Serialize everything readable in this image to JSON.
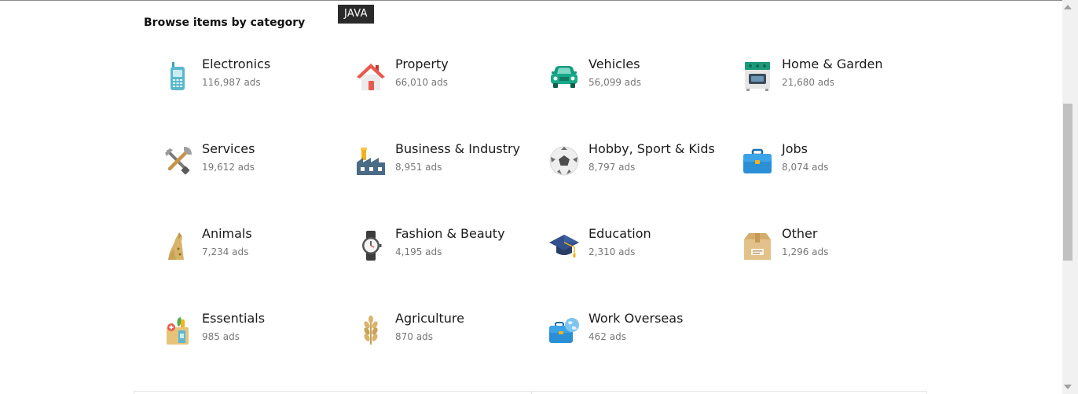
{
  "page": {
    "title": "Browse items by category"
  },
  "tooltip": {
    "text": "JAVA"
  },
  "categories": [
    {
      "label": "Electronics",
      "count": "116,987 ads",
      "icon": "phone-icon"
    },
    {
      "label": "Property",
      "count": "66,010 ads",
      "icon": "house-icon"
    },
    {
      "label": "Vehicles",
      "count": "56,099 ads",
      "icon": "car-icon"
    },
    {
      "label": "Home & Garden",
      "count": "21,680 ads",
      "icon": "stove-icon"
    },
    {
      "label": "Services",
      "count": "19,612 ads",
      "icon": "tools-icon"
    },
    {
      "label": "Business & Industry",
      "count": "8,951 ads",
      "icon": "factory-icon"
    },
    {
      "label": "Hobby, Sport & Kids",
      "count": "8,797 ads",
      "icon": "football-icon"
    },
    {
      "label": "Jobs",
      "count": "8,074 ads",
      "icon": "briefcase-icon"
    },
    {
      "label": "Animals",
      "count": "7,234 ads",
      "icon": "dog-icon"
    },
    {
      "label": "Fashion & Beauty",
      "count": "4,195 ads",
      "icon": "watch-icon"
    },
    {
      "label": "Education",
      "count": "2,310 ads",
      "icon": "graduation-cap-icon"
    },
    {
      "label": "Other",
      "count": "1,296 ads",
      "icon": "box-icon"
    },
    {
      "label": "Essentials",
      "count": "985 ads",
      "icon": "grocery-bag-icon"
    },
    {
      "label": "Agriculture",
      "count": "870 ads",
      "icon": "wheat-icon"
    },
    {
      "label": "Work Overseas",
      "count": "462 ads",
      "icon": "globe-briefcase-icon"
    }
  ]
}
